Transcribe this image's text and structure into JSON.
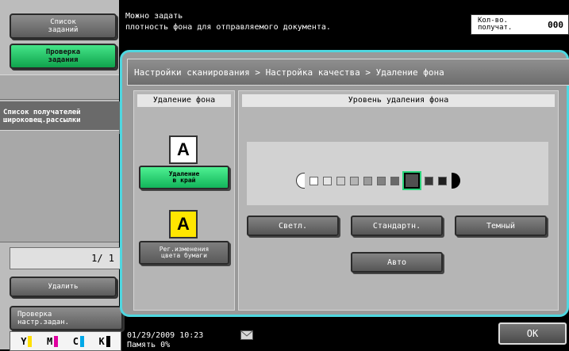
{
  "sidebar": {
    "job_list_label": "Список\nзаданий",
    "job_check_label": "Проверка\nзадания",
    "recipients_label": "Список получателей\nшироковещ.рассылки",
    "page_indicator": "1/  1",
    "delete_label": "Удалить",
    "check_settings_label": "Проверка\nнастр.задан.",
    "toner": [
      {
        "letter": "Y",
        "color": "#ffe000"
      },
      {
        "letter": "M",
        "color": "#e000a0"
      },
      {
        "letter": "C",
        "color": "#00a8e8"
      },
      {
        "letter": "K",
        "color": "#000000"
      }
    ]
  },
  "header": {
    "message": "Можно задать\nплотность фона для отправляемого документа.",
    "copies_label": "Кол-во.\nполучат.",
    "copies_value": "000"
  },
  "main": {
    "breadcrumb": "Настройки сканирования > Настройка качества > Удаление фона",
    "bg_removal": {
      "header": "Удаление фона",
      "edge_label": "Удаление\nв край",
      "paper_label": "Рег.изменения\nцвета бумаги",
      "icon_letter": "A"
    },
    "level": {
      "header": "Уровень удаления фона",
      "levels": [
        "#ffffff",
        "#e6e6e6",
        "#cdcdcd",
        "#b4b4b4",
        "#9b9b9b",
        "#828282",
        "#696969",
        "#505050",
        "#383838",
        "#1f1f1f"
      ],
      "selected_index": 7,
      "light_label": "Светл.",
      "standard_label": "Стандартн.",
      "dark_label": "Темный",
      "auto_label": "Авто"
    }
  },
  "footer": {
    "status": "01/29/2009    10:23\nПамять        0%",
    "ok_label": "OK"
  },
  "colors": {
    "accent": "#4fd7e0",
    "active_green": "#12b55a"
  }
}
